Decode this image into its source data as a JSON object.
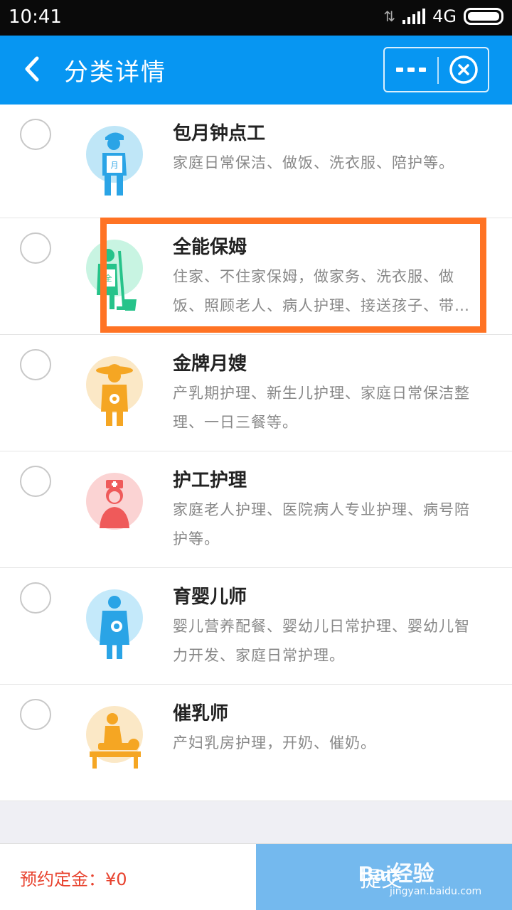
{
  "status_bar": {
    "time": "10:41",
    "network": "4G"
  },
  "nav": {
    "title": "分类详情"
  },
  "services": [
    {
      "name": "包月钟点工",
      "desc": "家庭日常保洁、做饭、洗衣服、陪护等。",
      "icon": "monthly-cleaner-icon"
    },
    {
      "name": "全能保姆",
      "desc": "住家、不住家保姆，做家务、洗衣服、做饭、照顾老人、病人护理、接送孩子、带…",
      "icon": "all-round-nanny-icon"
    },
    {
      "name": "金牌月嫂",
      "desc": "产乳期护理、新生儿护理、家庭日常保洁整理、一日三餐等。",
      "icon": "maternity-nurse-icon"
    },
    {
      "name": "护工护理",
      "desc": "家庭老人护理、医院病人专业护理、病号陪护等。",
      "icon": "nurse-icon"
    },
    {
      "name": "育婴儿师",
      "desc": "婴儿营养配餐、婴幼儿日常护理、婴幼儿智力开发、家庭日常护理。",
      "icon": "infant-caregiver-icon"
    },
    {
      "name": "催乳师",
      "desc": "产妇乳房护理，开奶、催奶。",
      "icon": "lactation-massage-icon"
    }
  ],
  "footer": {
    "deposit_label": "预约定金：¥0",
    "submit_label": "提交"
  },
  "watermark": {
    "main": "Bai经验",
    "sub": "jingyan.baidu.com"
  },
  "colors": {
    "nav_bg": "#0796f2",
    "highlight": "#ff7324",
    "deposit_text": "#e8432f",
    "submit_bg": "#74b9ee"
  }
}
